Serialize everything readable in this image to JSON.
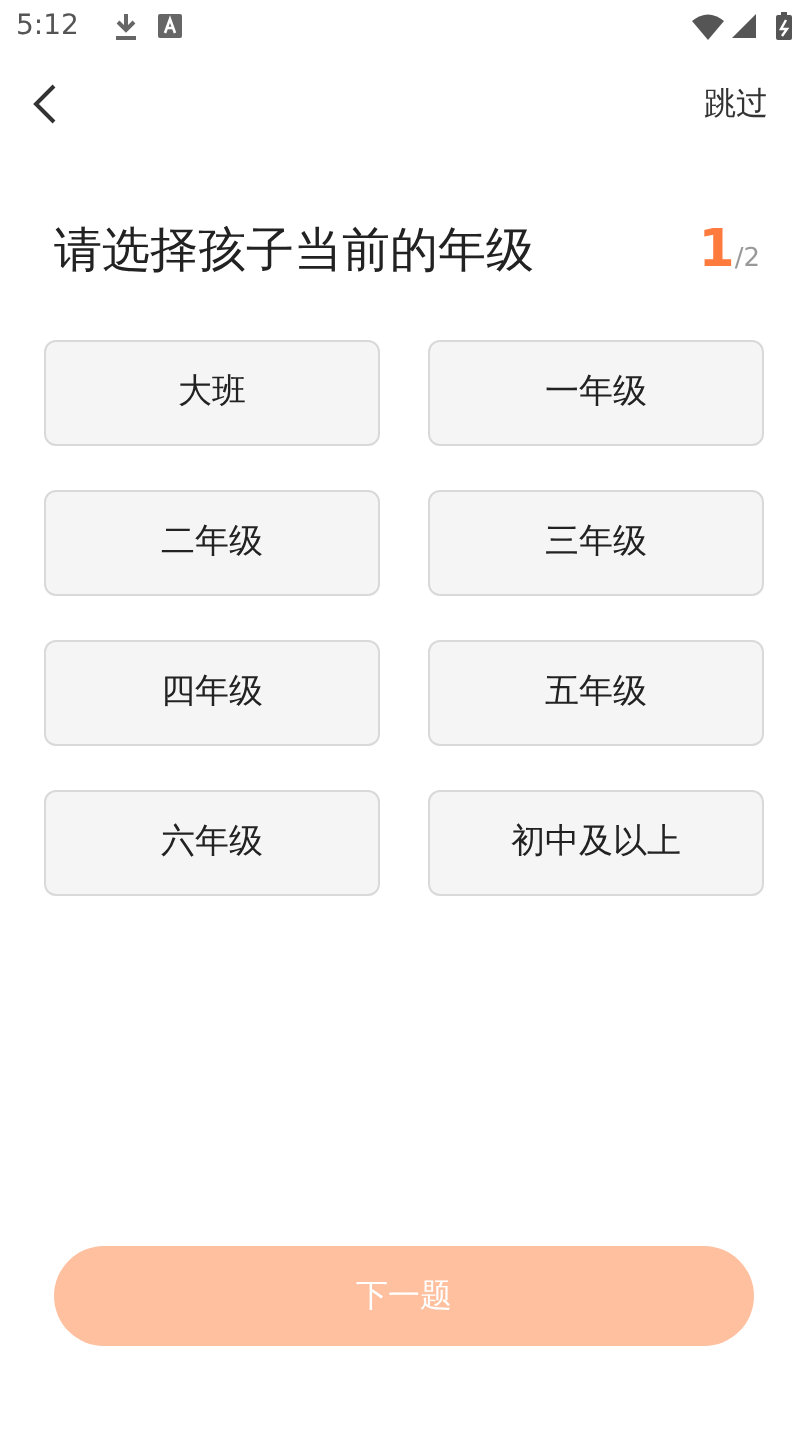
{
  "status_bar": {
    "time": "5:12"
  },
  "header": {
    "skip": "跳过"
  },
  "question": {
    "title": "请选择孩子当前的年级",
    "current": "1",
    "total": "/2"
  },
  "options": [
    {
      "label": "大班",
      "selected": false
    },
    {
      "label": "一年级",
      "selected": false
    },
    {
      "label": "二年级",
      "selected": false
    },
    {
      "label": "三年级",
      "selected": false
    },
    {
      "label": "四年级",
      "selected": false
    },
    {
      "label": "五年级",
      "selected": false
    },
    {
      "label": "六年级",
      "selected": false
    },
    {
      "label": "初中及以上",
      "selected": false
    }
  ],
  "next_button": {
    "label": "下一题",
    "disabled": true
  }
}
